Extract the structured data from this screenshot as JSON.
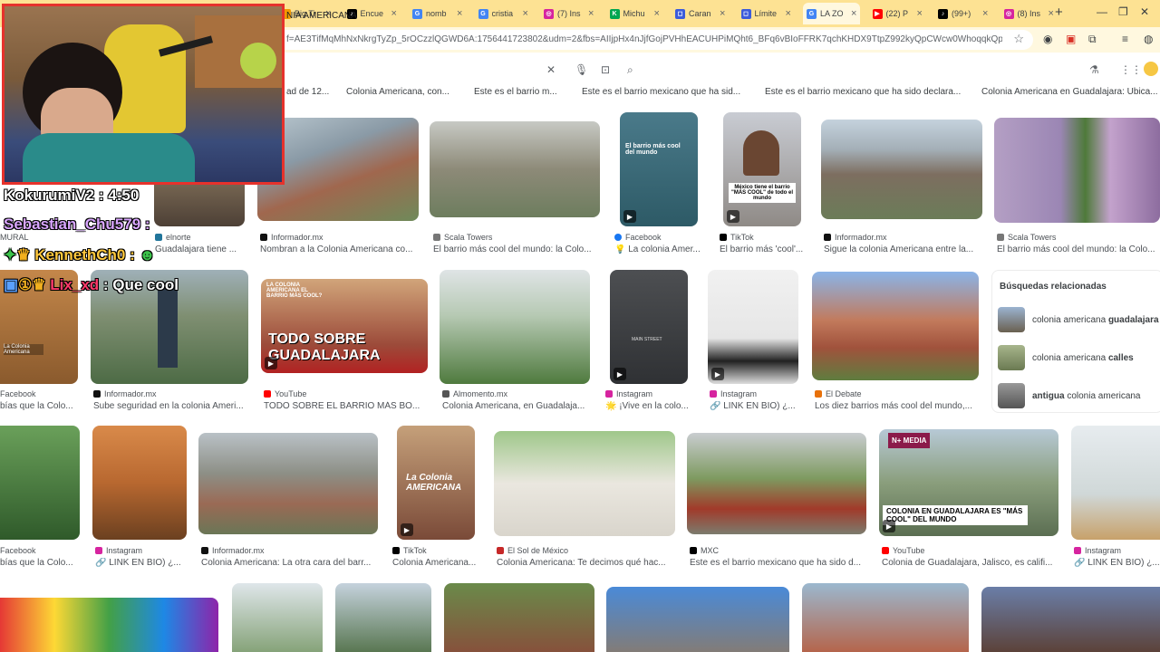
{
  "browser": {
    "tabs": [
      {
        "label": "Big Ti",
        "color": "#f29900",
        "glyph": ""
      },
      {
        "label": "Encue",
        "color": "#000000",
        "glyph": "♪"
      },
      {
        "label": "nomb",
        "color": "#4285f4",
        "glyph": "G"
      },
      {
        "label": "cristia",
        "color": "#4285f4",
        "glyph": "G"
      },
      {
        "label": "(7) Ins",
        "color": "#d6249f",
        "glyph": "◎"
      },
      {
        "label": "Michu",
        "color": "#00a651",
        "glyph": "K"
      },
      {
        "label": "Caran",
        "color": "#3b5bdb",
        "glyph": "◻"
      },
      {
        "label": "Límite",
        "color": "#3b5bdb",
        "glyph": "◻"
      },
      {
        "label": "LA ZO",
        "color": "#4285f4",
        "glyph": "G"
      },
      {
        "label": "(22) P",
        "color": "#ff0000",
        "glyph": "▶"
      },
      {
        "label": "(99+)",
        "color": "#000000",
        "glyph": "♪"
      },
      {
        "label": "(8) Ins",
        "color": "#d6249f",
        "glyph": "◎"
      }
    ],
    "new_tab": "+",
    "url": "f=AE3TifMqMhNxNkrgTyZp_5rOCzzlQGWD6A:1756441723802&udm=2&fbs=AIIjpHx4nJjfGojPVHhEACUHPiMQht6_BFq6vBIoFFRK7qchKHDX9TtpZ992kyQpCWcw0WhoqqkQpEwliVZ..."
  },
  "search": {
    "query": "NIA AMERICANA"
  },
  "chips": [
    "ad de 12...",
    "Colonia Americana, con...",
    "Este es el barrio m...",
    "Este es el barrio mexicano que ha sid...",
    "Este es el barrio mexicano que ha sido declara...",
    "Colonia Americana en Guadalajara: Ubica..."
  ],
  "results": {
    "row1": [
      {
        "source": "elnorte",
        "caption": "Guadalajara tiene ..."
      },
      {
        "source": "Informador.mx",
        "caption": "Nombran a la Colonia Americana co..."
      },
      {
        "source": "Scala Towers",
        "caption": "El barrio más cool del mundo: la Colo..."
      },
      {
        "source": "Facebook",
        "caption": "💡 La colonia Amer..."
      },
      {
        "source": "TikTok",
        "caption": "El barrio más 'cool'..."
      },
      {
        "source": "Informador.mx",
        "caption": "Sigue la colonia Americana entre la..."
      },
      {
        "source": "Scala Towers",
        "caption": "El barrio más cool del mundo: la Colo..."
      }
    ],
    "row1_left_source": "MURAL",
    "row2": [
      {
        "source": "Facebook",
        "caption": "bías que la Colo..."
      },
      {
        "source": "Informador.mx",
        "caption": "Sube seguridad en la colonia Ameri..."
      },
      {
        "source": "YouTube",
        "caption": "TODO SOBRE EL BARRIO MÁS BO..."
      },
      {
        "source": "Almomento.mx",
        "caption": "Colonia Americana, en Guadalaja..."
      },
      {
        "source": "Instagram",
        "caption": "🌟 ¡Vive en la colo..."
      },
      {
        "source": "Instagram",
        "caption": "🔗 LINK EN BIO) ¿..."
      },
      {
        "source": "El Debate",
        "caption": "Los diez barrios más cool del mundo,..."
      }
    ],
    "row2_thumb_texts": {
      "left_thumb": "La Colonia Americana",
      "yt_top": "LA COLONIA AMERICANA EL BARRIO MÁS COOL?",
      "yt_main": "TODO SOBRE GUADALAJARA",
      "building": "MAIN STREET"
    },
    "row3": [
      {
        "source": "Facebook",
        "caption": "bías que la Colo..."
      },
      {
        "source": "Instagram",
        "caption": "🔗 LINK EN BIO) ¿..."
      },
      {
        "source": "Informador.mx",
        "caption": "Colonia Americana: La otra cara del barr..."
      },
      {
        "source": "TikTok",
        "caption": "Colonia Americana..."
      },
      {
        "source": "El Sol de México",
        "caption": "Colonia Americana: Te decimos qué hac..."
      },
      {
        "source": "MXC",
        "caption": "Este es el barrio mexicano que ha sido d..."
      },
      {
        "source": "YouTube",
        "caption": "Colonia de Guadalajara, Jalisco, es califi..."
      },
      {
        "source": "Instagram",
        "caption": "🔗 LINK EN BIO) ¿..."
      }
    ],
    "row3_thumb_texts": {
      "tiktok": "La Colonia AMERICANA",
      "media_badge": "N+ MEDIA",
      "yt_banner": "COLONIA EN GUADALAJARA ES \"MÁS COOL\" DEL MUNDO"
    }
  },
  "related": {
    "title": "Búsquedas relacionadas",
    "items": [
      {
        "prefix": "colonia americana ",
        "bold": "guadalajara"
      },
      {
        "prefix": "colonia americana ",
        "bold": "calles"
      },
      {
        "bold": "antigua",
        "suffix": " colonia americana"
      }
    ]
  },
  "row1_thumb_texts": {
    "facebook": "El barrio más cool del mundo",
    "tiktok": "México tiene el barrio \"MÁS COOL\" de todo el mundo"
  },
  "stream_overlay": {
    "timer": "4:50",
    "chat": [
      {
        "user": "KokurumiV2",
        "sep": " : ",
        "msg": "",
        "color": "#ffffff"
      },
      {
        "user": "Sebastian_Chu579",
        "sep": " : ",
        "msg": "",
        "color": "#d9a6ff"
      },
      {
        "user": "KennethCh0",
        "sep": " : ",
        "msg": "",
        "color": "#ffc83d"
      },
      {
        "user": "Lix_xd",
        "sep": " : ",
        "msg": "Que cool",
        "color": "#ff3b6b"
      }
    ]
  }
}
